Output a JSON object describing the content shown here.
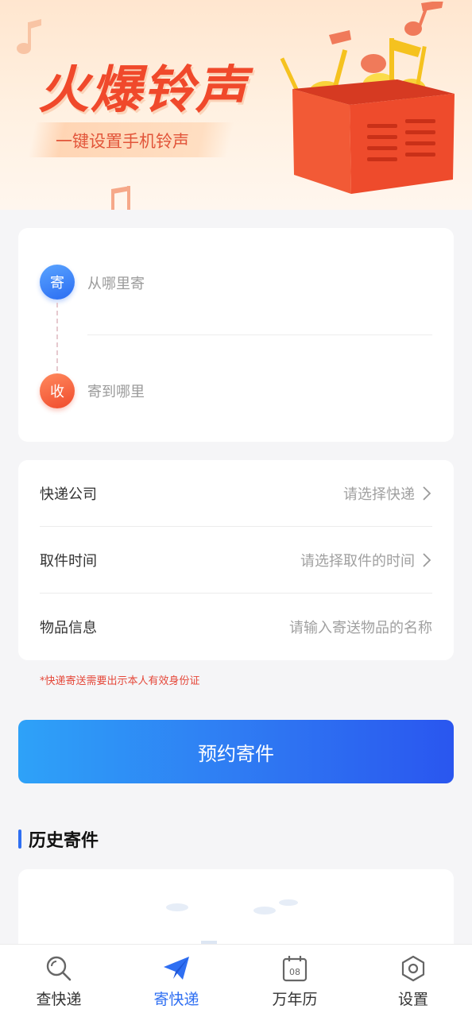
{
  "banner": {
    "title": "火爆铃声",
    "subtitle": "一键设置手机铃声"
  },
  "address": {
    "send_badge": "寄",
    "recv_badge": "收",
    "from_placeholder": "从哪里寄",
    "to_placeholder": "寄到哪里"
  },
  "form": {
    "rows": [
      {
        "label": "快递公司",
        "value": "请选择快递"
      },
      {
        "label": "取件时间",
        "value": "请选择取件的时间"
      },
      {
        "label": "物品信息",
        "value": "请输入寄送物品的名称"
      }
    ]
  },
  "notice": "*快递寄送需要出示本人有效身份证",
  "cta_label": "预约寄件",
  "history": {
    "title": "历史寄件"
  },
  "tabbar": {
    "items": [
      {
        "label": "查快递",
        "icon": "search-icon"
      },
      {
        "label": "寄快递",
        "icon": "paper-plane-icon"
      },
      {
        "label": "万年历",
        "icon": "calendar-icon",
        "calendar_day": "08"
      },
      {
        "label": "设置",
        "icon": "hexagon-settings-icon"
      }
    ],
    "active_index": 1
  },
  "colors": {
    "accent_blue": "#2f6ff2",
    "banner_red": "#f0492b",
    "notice_red": "#e5483a"
  }
}
